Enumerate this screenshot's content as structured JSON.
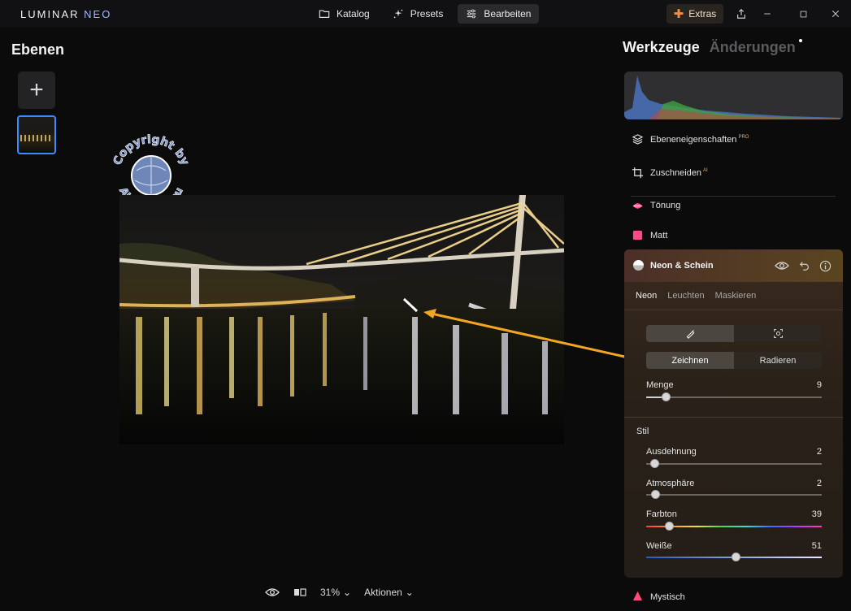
{
  "app": {
    "logo_main": "LUMINAR",
    "logo_sub": "NEO"
  },
  "nav": {
    "tabs": [
      {
        "label": "Katalog",
        "icon": "folder-icon"
      },
      {
        "label": "Presets",
        "icon": "sparkle-icon"
      },
      {
        "label": "Bearbeiten",
        "icon": "sliders-icon",
        "active": true
      }
    ],
    "extras_label": "Extras"
  },
  "layers": {
    "title": "Ebenen"
  },
  "watermark": {
    "text_top": "Copyright by",
    "text_bottom": "Ahadesign.eu"
  },
  "bottom": {
    "zoom": "31%",
    "actions": "Aktionen"
  },
  "panel": {
    "tab_tools": "Werkzeuge",
    "tab_changes": "Änderungen",
    "tools": [
      {
        "label": "Ebeneneigenschaften",
        "badge": "PRO",
        "icon": "layers-icon"
      },
      {
        "label": "Zuschneiden",
        "badge": "AI",
        "icon": "crop-icon"
      },
      {
        "label": "Tönung",
        "badge": "",
        "icon": "tint-icon"
      },
      {
        "label": "Matt",
        "badge": "",
        "icon": "matte-icon"
      }
    ],
    "neon": {
      "title": "Neon & Schein",
      "subtabs": [
        "Neon",
        "Leuchten",
        "Maskieren"
      ],
      "mode_draw": "Zeichnen",
      "mode_erase": "Radieren",
      "amount_label": "Menge",
      "amount_value": "9",
      "style_label": "Stil",
      "sliders": [
        {
          "label": "Ausdehnung",
          "value": "2"
        },
        {
          "label": "Atmosphäre",
          "value": "2"
        },
        {
          "label": "Farbton",
          "value": "39"
        },
        {
          "label": "Weiße",
          "value": "51"
        }
      ]
    },
    "next_tool": "Mystisch"
  },
  "colors": {
    "accent_blue": "#3b8cff",
    "extras_orange": "#ff8c3a",
    "annotation_arrow": "#f2a623"
  }
}
